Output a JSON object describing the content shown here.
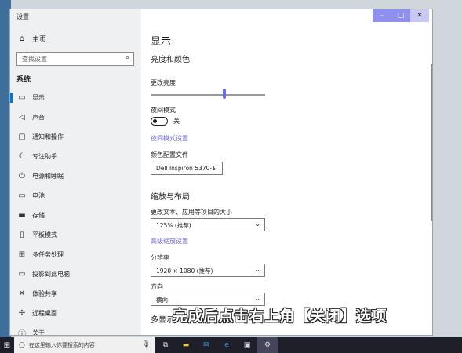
{
  "window": {
    "title": "设置"
  },
  "window_buttons": {
    "minimize": "–",
    "maximize": "□",
    "close": "✕"
  },
  "sidebar": {
    "home_label": "主页",
    "search_placeholder": "查找设置",
    "section": "系统",
    "items": [
      {
        "label": "显示",
        "icon": "monitor-icon"
      },
      {
        "label": "声音",
        "icon": "speaker-icon"
      },
      {
        "label": "通知和操作",
        "icon": "notification-icon"
      },
      {
        "label": "专注助手",
        "icon": "moon-icon"
      },
      {
        "label": "电源和睡眠",
        "icon": "power-icon"
      },
      {
        "label": "电池",
        "icon": "battery-icon"
      },
      {
        "label": "存储",
        "icon": "storage-icon"
      },
      {
        "label": "平板模式",
        "icon": "tablet-icon"
      },
      {
        "label": "多任务处理",
        "icon": "multitask-icon"
      },
      {
        "label": "投影到此电脑",
        "icon": "project-icon"
      },
      {
        "label": "体验共享",
        "icon": "share-icon"
      },
      {
        "label": "远程桌面",
        "icon": "remote-icon"
      },
      {
        "label": "关于",
        "icon": "info-icon"
      }
    ]
  },
  "main": {
    "page_title": "显示",
    "brightness_section": "亮度和颜色",
    "brightness_label": "更改亮度",
    "night_mode_label": "夜间模式",
    "night_mode_state": "关",
    "night_mode_link": "夜间模式设置",
    "color_profile_label": "颜色配置文件",
    "color_profile_value": "Dell Inspiron 5370-1",
    "scale_section": "缩放与布局",
    "scale_label": "更改文本、应用等项目的大小",
    "scale_value": "125% (推荐)",
    "advanced_scale_link": "高级缩放设置",
    "resolution_label": "分辨率",
    "resolution_value": "1920 × 1080 (推荐)",
    "orientation_label": "方向",
    "orientation_value": "横向",
    "multi_display_partial": "多显示"
  },
  "brightness": {
    "level_fraction": 0.63
  },
  "caption": "完成后点击右上角【关闭】选项",
  "taskbar": {
    "search_placeholder": "在这里输入你要搜索的内容"
  }
}
